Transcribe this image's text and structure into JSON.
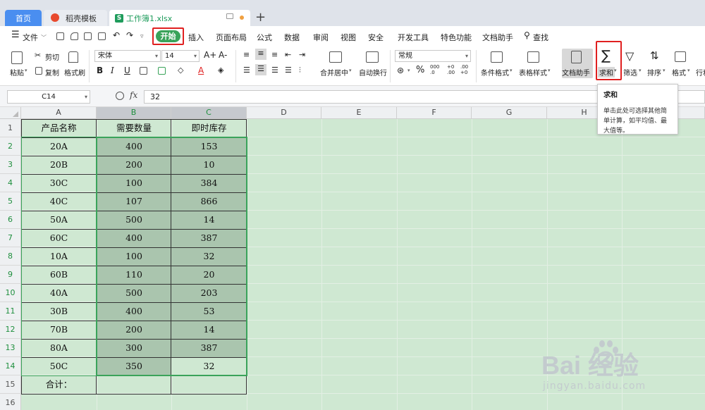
{
  "tabs": {
    "home": "首页",
    "template": "稻壳模板",
    "file": "工作簿1.xlsx",
    "new_tab": "+"
  },
  "menu": {
    "file": "文件",
    "start": "开始",
    "items": [
      "插入",
      "页面布局",
      "公式",
      "数据",
      "审阅",
      "视图",
      "安全",
      "开发工具",
      "特色功能",
      "文档助手"
    ],
    "search": "查找"
  },
  "ribbon": {
    "paste": "粘贴",
    "cut": "剪切",
    "copy": "复制",
    "format_painter": "格式刷",
    "font_name": "宋体",
    "font_size": "14",
    "grow_font": "A+",
    "shrink_font": "A-",
    "merge_center": "合并居中",
    "wrap_text": "自动换行",
    "number_format": "常规",
    "conditional_format": "条件格式",
    "table_style": "表格样式",
    "doc_assistant": "文档助手",
    "sum": "求和",
    "filter": "筛选",
    "sort": "排序",
    "format": "格式",
    "rowcol": "行和"
  },
  "formula_bar": {
    "cell_ref": "C14",
    "fx": "fx",
    "value": "32"
  },
  "sheet": {
    "columns": [
      "A",
      "B",
      "C",
      "D",
      "E",
      "F",
      "G",
      "H"
    ],
    "rows": [
      "1",
      "2",
      "3",
      "4",
      "5",
      "6",
      "7",
      "8",
      "9",
      "10",
      "11",
      "12",
      "13",
      "14",
      "15",
      "16"
    ],
    "header": [
      "产品名称",
      "需要数量",
      "即时库存"
    ],
    "data": [
      [
        "20A",
        "400",
        "153"
      ],
      [
        "20B",
        "200",
        "10"
      ],
      [
        "30C",
        "100",
        "384"
      ],
      [
        "40C",
        "107",
        "866"
      ],
      [
        "50A",
        "500",
        "14"
      ],
      [
        "60C",
        "400",
        "387"
      ],
      [
        "10A",
        "100",
        "32"
      ],
      [
        "60B",
        "110",
        "20"
      ],
      [
        "40A",
        "500",
        "203"
      ],
      [
        "30B",
        "400",
        "53"
      ],
      [
        "70B",
        "200",
        "14"
      ],
      [
        "80A",
        "300",
        "387"
      ],
      [
        "50C",
        "350",
        "32"
      ]
    ],
    "total_label": "合计："
  },
  "tooltip": {
    "title": "求和",
    "body": "单击此处可选择其他简单计算，如平均值、最大值等。"
  },
  "watermark": {
    "text": "Bai  经验",
    "url": "jingyan.baidu.com"
  },
  "colors": {
    "sheet_bg": "#cfe8d2",
    "selection": "#aac5ae",
    "accent_green": "#3aa35a",
    "highlight_red": "#e02020",
    "home_tab": "#4a8ef0"
  }
}
